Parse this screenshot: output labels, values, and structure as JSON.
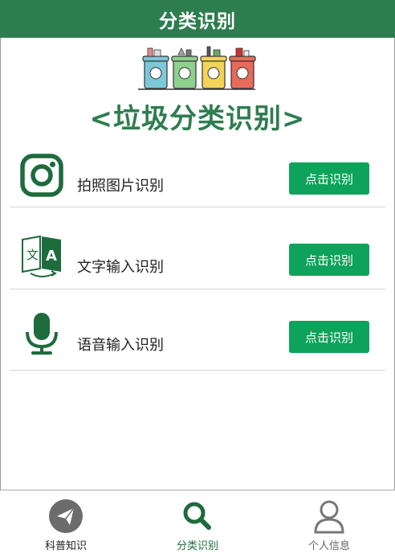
{
  "header": {
    "title": "分类识别"
  },
  "banner": {
    "title": "<垃圾分类识别>"
  },
  "rows": [
    {
      "label": "拍照图片识别",
      "button": "点击识别",
      "icon": "camera-icon"
    },
    {
      "label": "文字输入识别",
      "button": "点击识别",
      "icon": "translate-icon"
    },
    {
      "label": "语音输入识别",
      "button": "点击识别",
      "icon": "microphone-icon"
    }
  ],
  "tabs": [
    {
      "label": "科普知识",
      "icon": "paper-plane-icon",
      "color": "#222222"
    },
    {
      "label": "分类识别",
      "icon": "search-icon",
      "color": "#1e6b3c",
      "active": true
    },
    {
      "label": "个人信息",
      "icon": "user-icon",
      "color": "#666666"
    }
  ],
  "colors": {
    "primary": "#2e7d4f",
    "button": "#0ea35a",
    "icon_green": "#1e6b3c"
  }
}
